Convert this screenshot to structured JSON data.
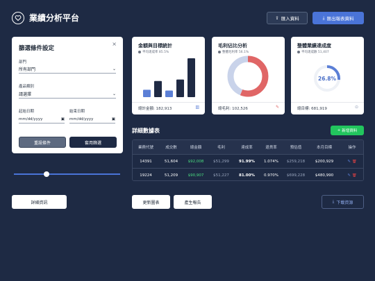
{
  "app": {
    "title": "業績分析平台"
  },
  "header": {
    "import_label": "匯入資料",
    "export_label": "匯出報表資料"
  },
  "filters": {
    "title": "篩選條件設定",
    "department_label": "部門",
    "department_value": "所有部門",
    "category_label": "產品類別",
    "category_value": "請選擇",
    "start_label": "起始日期",
    "end_label": "結束日期",
    "start_value": "mm/dd/yyyy",
    "end_value": "mm/dd/yyyy",
    "reset_label": "重設條件",
    "apply_label": "套用篩選"
  },
  "slider": {
    "value": 0.28
  },
  "cards": {
    "amount": {
      "title": "金額與目標統計",
      "subtitle": "平均達成率 85.5%",
      "footer": "總計金額: 182,913"
    },
    "margin": {
      "title": "毛利佔比分析",
      "subtitle": "整體毛利率 56.1%",
      "footer": "總毛利: 102,526"
    },
    "achievement": {
      "title": "整體業績達成度",
      "subtitle": "平均達成數 51,407",
      "footer": "總目標: 681,919",
      "center_label": "26.8%"
    }
  },
  "chart_data": [
    {
      "type": "bar",
      "categories": [
        "1",
        "2",
        "3",
        "4",
        "5"
      ],
      "values": [
        1.0,
        2.2,
        0.9,
        2.4,
        5.3
      ],
      "colors": [
        "#5b7fd6",
        "#1f2a44",
        "#5b7fd6",
        "#1f2a44",
        "#1f2a44"
      ]
    },
    {
      "type": "pie",
      "values": [
        56.1,
        43.9
      ],
      "colors": [
        "#e06666",
        "#c9d3ea"
      ]
    },
    {
      "type": "pie",
      "values": [
        26.8,
        73.2
      ],
      "colors": [
        "#5b7fd6",
        "#eef1f6"
      ]
    }
  ],
  "table": {
    "section_title": "詳細數據表",
    "add_label": "新增資料",
    "headers": [
      "業務代號",
      "成交數",
      "總金額",
      "毛利",
      "達成率",
      "退貨率",
      "預估值",
      "本月目標",
      "操作"
    ],
    "rows": [
      [
        "14391",
        "51,604",
        "$92,008",
        "$51,299",
        "91.99%",
        "1.074%",
        "$259,218",
        "$200,929"
      ],
      [
        "19224",
        "51,209",
        "$90,907",
        "$51,227",
        "81.00%",
        "0.970%",
        "$699,228",
        "$480,990"
      ]
    ]
  },
  "footer": {
    "detail_label": "詳細資訊",
    "update_label": "更新圖表",
    "report_label": "產生報告",
    "download_label": "下載資源"
  },
  "colors": {
    "background": "#1e2a44",
    "accent": "#4a74d8",
    "success": "#22c55e",
    "danger": "#e06666"
  }
}
